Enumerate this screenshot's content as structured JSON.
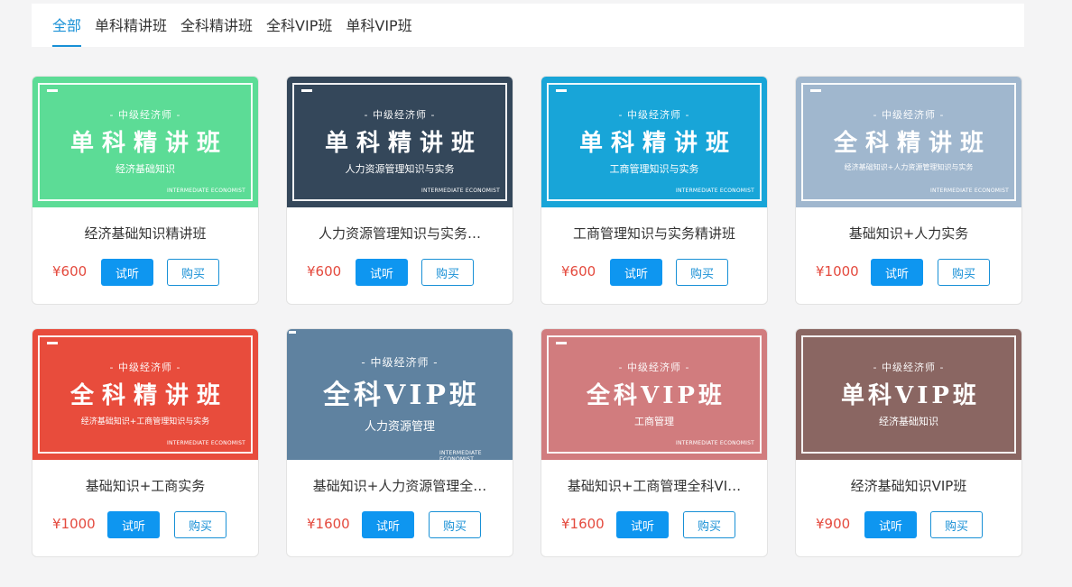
{
  "tabs": [
    {
      "label": "全部",
      "active": true
    },
    {
      "label": "单科精讲班",
      "active": false
    },
    {
      "label": "全科精讲班",
      "active": false
    },
    {
      "label": "全科VIP班",
      "active": false
    },
    {
      "label": "单科VIP班",
      "active": false
    }
  ],
  "banner_subtitle": "- 中级经济师 -",
  "banner_english": "INTERMEDIATE ECONOMIST",
  "buttons": {
    "listen": "试听",
    "buy": "购买"
  },
  "courses": [
    {
      "title": "经济基础知识精讲班",
      "price": "¥600",
      "banner_title": "单科精讲班",
      "banner_desc": "经济基础知识",
      "color": "#5cdc96"
    },
    {
      "title": "人力资源管理知识与实务…",
      "price": "¥600",
      "banner_title": "单科精讲班",
      "banner_desc": "人力资源管理知识与实务",
      "color": "#34475a"
    },
    {
      "title": "工商管理知识与实务精讲班",
      "price": "¥600",
      "banner_title": "单科精讲班",
      "banner_desc": "工商管理知识与实务",
      "color": "#18a5d8"
    },
    {
      "title": "基础知识+人力实务",
      "price": "¥1000",
      "banner_title": "全科精讲班",
      "banner_desc": "经济基础知识+人力资源管理知识与实务",
      "color": "#a0b7ce"
    },
    {
      "title": "基础知识+工商实务",
      "price": "¥1000",
      "banner_title": "全科精讲班",
      "banner_desc": "经济基础知识+工商管理知识与实务",
      "color": "#e84c3c"
    },
    {
      "title": "基础知识+人力资源管理全…",
      "price": "¥1600",
      "banner_title": "全科VIP班",
      "banner_desc": "人力资源管理",
      "color": "#5f82a0"
    },
    {
      "title": "基础知识+工商管理全科VI…",
      "price": "¥1600",
      "banner_title": "全科VIP班",
      "banner_desc": "工商管理",
      "color": "#d17c7e"
    },
    {
      "title": "经济基础知识VIP班",
      "price": "¥900",
      "banner_title": "单科VIP班",
      "banner_desc": "经济基础知识",
      "color": "#8a6662"
    }
  ]
}
